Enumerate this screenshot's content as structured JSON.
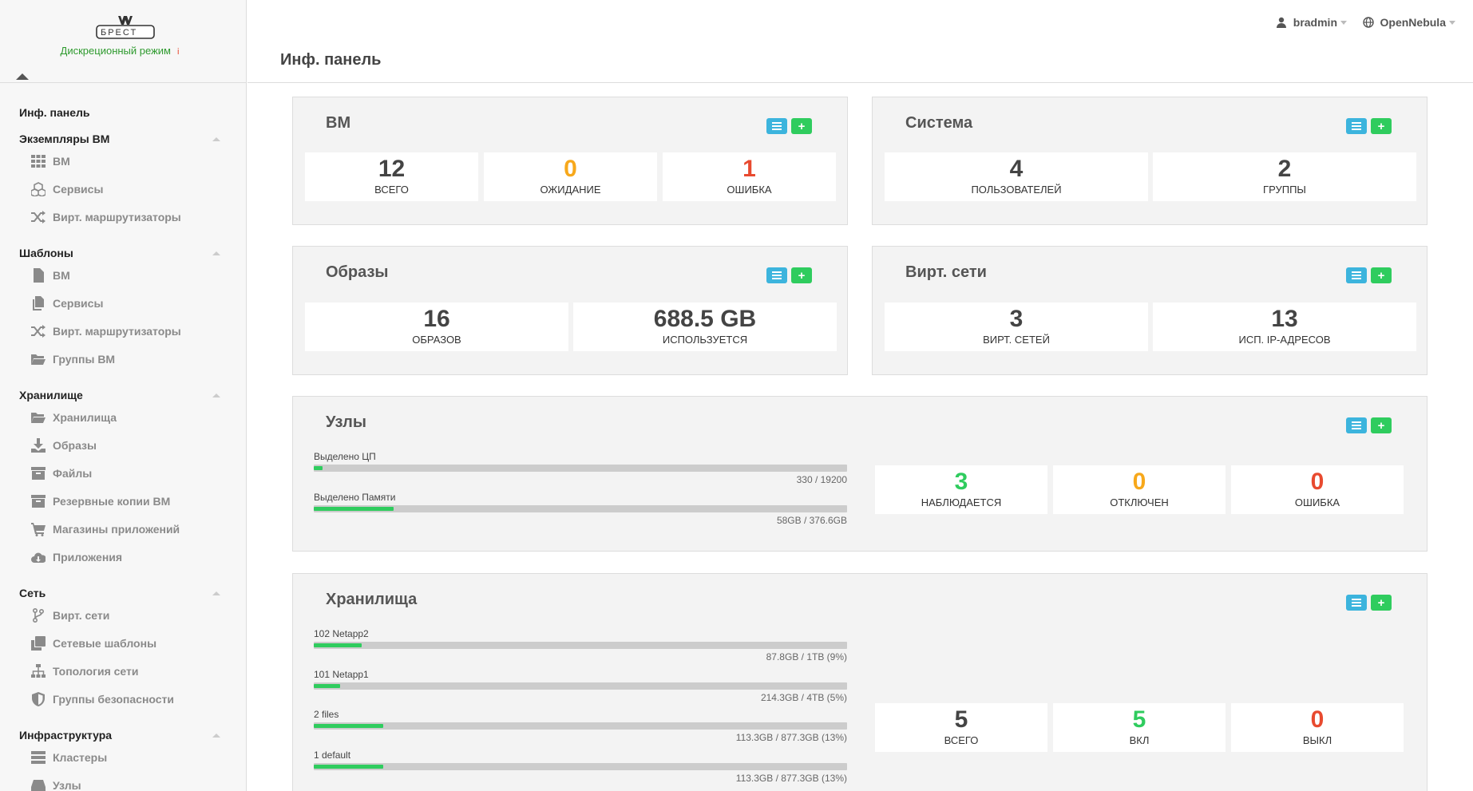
{
  "brand": {
    "logo_text": "БРЕСТ",
    "mode": "Дискреционный режим",
    "mode_info": "i"
  },
  "header": {
    "page_title": "Инф. панель",
    "user": "bradmin",
    "zone": "OpenNebula"
  },
  "sidebar": {
    "dashboard": "Инф. панель",
    "groups": [
      {
        "label": "Экземпляры ВМ",
        "items": [
          {
            "label": "ВМ",
            "icon": "grid-icon"
          },
          {
            "label": "Сервисы",
            "icon": "cubes-icon"
          },
          {
            "label": "Вирт. маршрутизаторы",
            "icon": "random-icon"
          }
        ]
      },
      {
        "label": "Шаблоны",
        "items": [
          {
            "label": "ВМ",
            "icon": "file-icon"
          },
          {
            "label": "Сервисы",
            "icon": "files-icon"
          },
          {
            "label": "Вирт. маршрутизаторы",
            "icon": "random-icon"
          },
          {
            "label": "Группы ВМ",
            "icon": "folder-open-icon"
          }
        ]
      },
      {
        "label": "Хранилище",
        "items": [
          {
            "label": "Хранилища",
            "icon": "folder-open-icon"
          },
          {
            "label": "Образы",
            "icon": "download-icon"
          },
          {
            "label": "Файлы",
            "icon": "archive-icon"
          },
          {
            "label": "Резервные копии ВМ",
            "icon": "archive-icon"
          },
          {
            "label": "Магазины приложений",
            "icon": "cart-icon"
          },
          {
            "label": "Приложения",
            "icon": "cloud-download-icon"
          }
        ]
      },
      {
        "label": "Сеть",
        "items": [
          {
            "label": "Вирт. сети",
            "icon": "code-fork-icon"
          },
          {
            "label": "Сетевые шаблоны",
            "icon": "clone-icon"
          },
          {
            "label": "Топология сети",
            "icon": "sitemap-icon"
          },
          {
            "label": "Группы безопасности",
            "icon": "shield-icon"
          }
        ]
      },
      {
        "label": "Инфраструктура",
        "items": [
          {
            "label": "Кластеры",
            "icon": "server-icon"
          },
          {
            "label": "Узлы",
            "icon": "hdd-icon"
          }
        ]
      }
    ]
  },
  "panels": {
    "vm": {
      "title": "ВМ",
      "stats": [
        {
          "value": "12",
          "label": "ВСЕГО",
          "color": "#444444"
        },
        {
          "value": "0",
          "label": "ОЖИДАНИЕ",
          "color": "#f7a81b"
        },
        {
          "value": "1",
          "label": "ОШИБКА",
          "color": "#e84a2f"
        }
      ]
    },
    "system": {
      "title": "Система",
      "stats": [
        {
          "value": "4",
          "label": "ПОЛЬЗОВАТЕЛЕЙ",
          "color": "#444444"
        },
        {
          "value": "2",
          "label": "ГРУППЫ",
          "color": "#444444"
        }
      ]
    },
    "images": {
      "title": "Образы",
      "stats": [
        {
          "value": "16",
          "label": "ОБРАЗОВ",
          "color": "#444444"
        },
        {
          "value": "688.5 GB",
          "label": "ИСПОЛЬЗУЕТСЯ",
          "color": "#444444"
        }
      ]
    },
    "vnets": {
      "title": "Вирт. сети",
      "stats": [
        {
          "value": "3",
          "label": "ВИРТ. СЕТЕЙ",
          "color": "#444444"
        },
        {
          "value": "13",
          "label": "ИСП. IP-АДРЕСОВ",
          "color": "#444444"
        }
      ]
    },
    "hosts": {
      "title": "Узлы",
      "bars": [
        {
          "label": "Выделено ЦП",
          "value": "330 / 19200",
          "fraction": 0.017
        },
        {
          "label": "Выделено Памяти",
          "value": "58GB / 376.6GB",
          "fraction": 0.15
        }
      ],
      "stats": [
        {
          "value": "3",
          "label": "НАБЛЮДАЕТСЯ",
          "color": "#2fcc5e"
        },
        {
          "value": "0",
          "label": "ОТКЛЮЧЕН",
          "color": "#f7a81b"
        },
        {
          "value": "0",
          "label": "ОШИБКА",
          "color": "#e84a2f"
        }
      ]
    },
    "datastores": {
      "title": "Хранилища",
      "bars": [
        {
          "label": "102 Netapp2",
          "value": "87.8GB / 1TB (9%)",
          "fraction": 0.09
        },
        {
          "label": "101 Netapp1",
          "value": "214.3GB / 4TB (5%)",
          "fraction": 0.05
        },
        {
          "label": "2 files",
          "value": "113.3GB / 877.3GB (13%)",
          "fraction": 0.13
        },
        {
          "label": "1 default",
          "value": "113.3GB / 877.3GB (13%)",
          "fraction": 0.13
        }
      ],
      "stats": [
        {
          "value": "5",
          "label": "ВСЕГО",
          "color": "#444444"
        },
        {
          "value": "5",
          "label": "ВКЛ",
          "color": "#2fcc5e"
        },
        {
          "value": "0",
          "label": "ВЫКЛ",
          "color": "#e84a2f"
        }
      ]
    }
  }
}
